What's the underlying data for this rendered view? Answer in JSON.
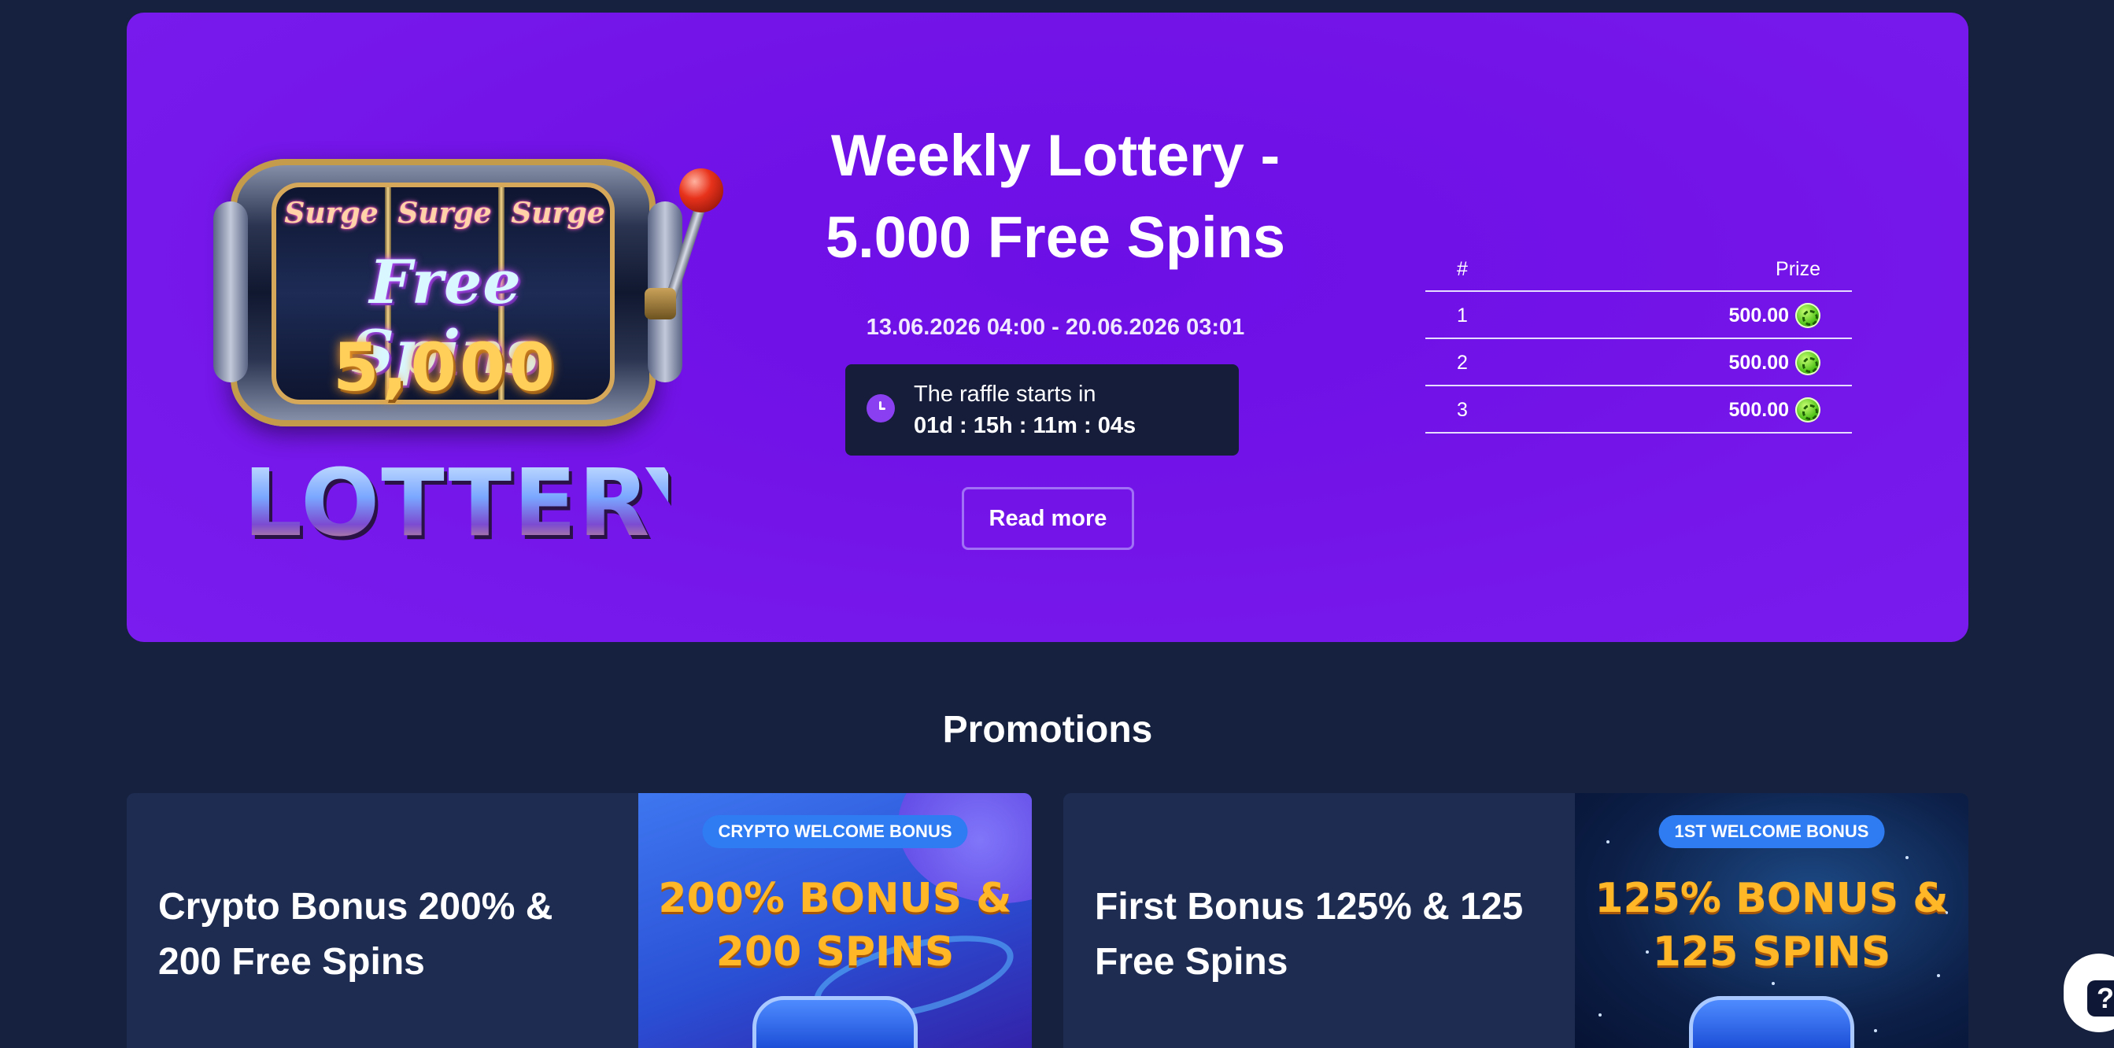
{
  "lottery": {
    "art": {
      "reel_words": [
        "Surge",
        "Surge",
        "Surge"
      ],
      "free_spins": "Free Spins",
      "amount": "5,000",
      "lottery": "LOTTERY"
    },
    "title_line1": "Weekly Lottery -",
    "title_line2": "5.000 Free Spins",
    "dates": "13.06.2026 04:00 - 20.06.2026 03:01",
    "countdown_label": "The raffle starts in",
    "countdown_time": "01d : 15h : 11m : 04s",
    "read_more_label": "Read more",
    "prize_table": {
      "header_rank": "#",
      "header_prize": "Prize",
      "rows": [
        {
          "rank": "1",
          "prize": "500.00",
          "icon": "coin-icon"
        },
        {
          "rank": "2",
          "prize": "500.00",
          "icon": "coin-icon"
        },
        {
          "rank": "3",
          "prize": "500.00",
          "icon": "coin-icon"
        }
      ]
    }
  },
  "promotions": {
    "heading": "Promotions",
    "cards": [
      {
        "title": "Crypto Bonus 200% & 200 Free Spins",
        "badge": "CRYPTO WELCOME BONUS",
        "headline_line1": "200% BONUS &",
        "headline_line2": "200 SPINS"
      },
      {
        "title": "First Bonus 125% & 125 Free Spins",
        "badge": "1ST WELCOME BONUS",
        "headline_line1": "125% BONUS &",
        "headline_line2": "125 SPINS"
      }
    ]
  },
  "help_widget": {
    "label": "?",
    "icon": "help-icon"
  },
  "colors": {
    "page_bg": "#15213f",
    "hero_bg": "#7313e8",
    "card_bg": "#1e2c52",
    "countdown_bg": "#161d3b",
    "accent_gold": "#ffb627"
  }
}
